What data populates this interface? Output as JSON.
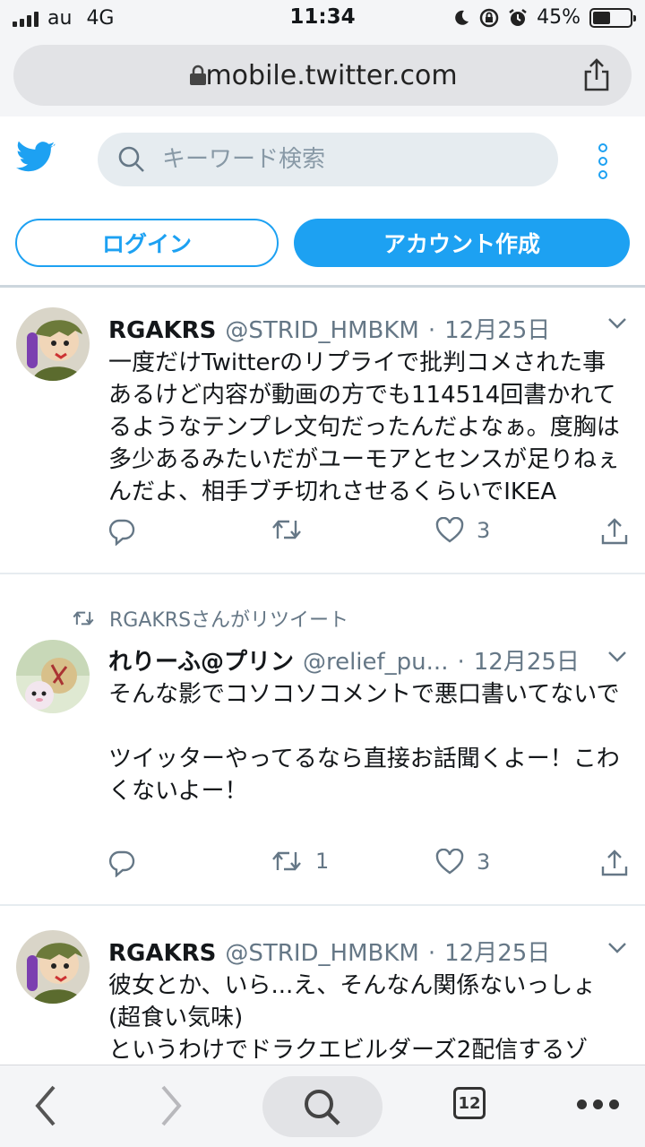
{
  "status_bar": {
    "carrier": "au",
    "network": "4G",
    "time": "11:34",
    "battery": "45%",
    "battery_level": 0.45
  },
  "browser": {
    "url": "mobile.twitter.com",
    "tab_count": "12"
  },
  "header": {
    "search_placeholder": "キーワード検索",
    "login_label": "ログイン",
    "signup_label": "アカウント作成"
  },
  "colors": {
    "brand": "#1da1f2",
    "text": "#14171a",
    "muted": "#657786"
  },
  "tweets": [
    {
      "name": "RGAKRS",
      "handle": "@STRID_HMBKM",
      "separator": "·",
      "date": "12月25日",
      "text": "一度だけTwitterのリプライで批判コメされた事あるけど内容が動画の方でも114514回書かれてるようなテンプレ文句だったんだよなぁ。度胸は多少あるみたいだがユーモアとセンスが足りねぇんだよ、相手ブチ切れさせるくらいでIKEA",
      "retweets": "",
      "likes": "3"
    },
    {
      "retweeted_by": "RGAKRSさんがリツイート",
      "name": "れりーふ@プリン",
      "handle": "@relief_pu...",
      "separator": "·",
      "date": "12月25日",
      "text": "そんな影でコソコソコメントで悪口書いてないで\n\nツイッターやってるなら直接お話聞くよー！こわくないよー！",
      "retweets": "1",
      "likes": "3"
    },
    {
      "name": "RGAKRS",
      "handle": "@STRID_HMBKM",
      "separator": "·",
      "date": "12月25日",
      "text": "彼女とか、いら...え、そんなん関係ないっしょ(超食い気味)\nというわけでドラクエビルダーズ2配信するゾ"
    }
  ]
}
